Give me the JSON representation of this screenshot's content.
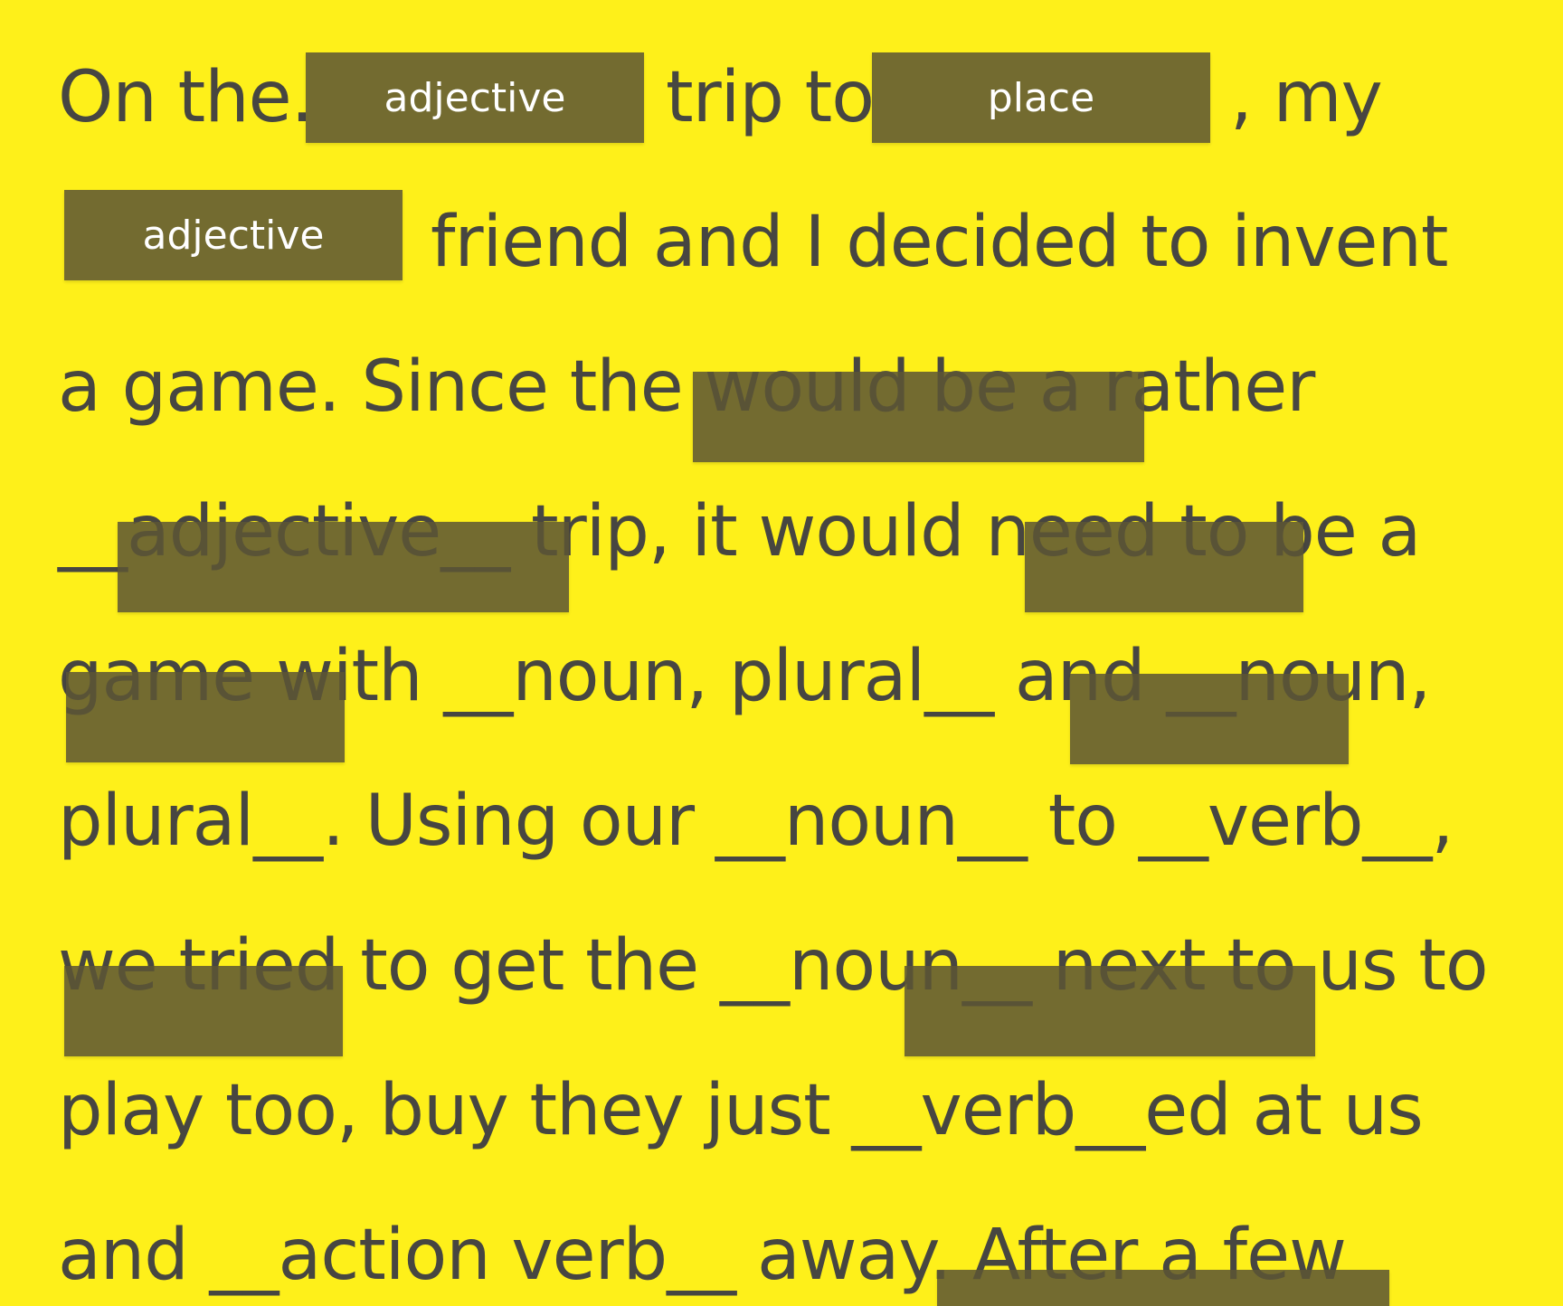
{
  "story": {
    "lines": [
      "On the.",
      "",
      "a game. Since the would be a rather",
      "__adjective__ trip, it would need to be a",
      "game with __noun, plural__ and __noun,",
      "plural__. Using our __noun__ to __verb__,",
      "we tried to get the __noun__ next to us to",
      "play too, buy they just __verb__ed at us",
      "and __action verb__ away. After a few"
    ],
    "line1_middle": "trip to",
    "line1_end": ", my",
    "line2_rest": "friend and I decided to invent"
  },
  "blanks": [
    {
      "label": "adjective"
    },
    {
      "label": "place"
    },
    {
      "label": "adjective"
    },
    {
      "label": ""
    },
    {
      "label": ""
    },
    {
      "label": ""
    },
    {
      "label": ""
    },
    {
      "label": ""
    },
    {
      "label": ""
    },
    {
      "label": ""
    },
    {
      "label": ""
    }
  ],
  "colors": {
    "background": "#FEF01A",
    "text": "#474641",
    "blank_fill": "#6E6624",
    "blank_text": "#FFFFFF"
  }
}
